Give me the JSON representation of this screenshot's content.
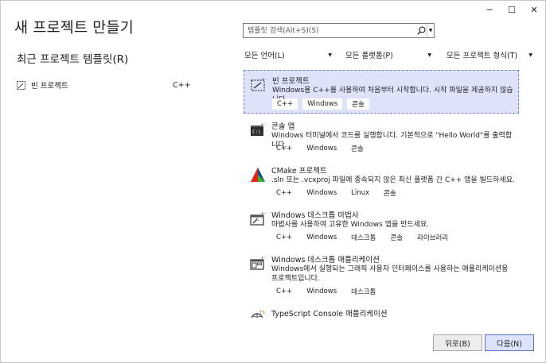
{
  "window_controls": {
    "minimize": "─",
    "maximize": "☐",
    "close": "✕"
  },
  "main_title": "새 프로젝트 만들기",
  "recent": {
    "title": "최근 프로젝트 템플릿(R)",
    "items": [
      {
        "label": "빈 프로젝트",
        "lang": "C++"
      }
    ]
  },
  "search": {
    "placeholder": "템플릿 검색(Alt+S)(S)"
  },
  "filters": [
    {
      "value": "모든 언어(L)"
    },
    {
      "value": "모든 플랫폼(P)"
    },
    {
      "value": "모든 프로젝트 형식(T)"
    }
  ],
  "templates": [
    {
      "name": "빈 프로젝트",
      "icon": "empty-project-icon",
      "description": "Windows용 C++를 사용하여 처음부터 시작합니다. 시작 파일을 제공하지 않습니다.",
      "tags": [
        "C++",
        "Windows",
        "콘솔"
      ],
      "selected": true
    },
    {
      "name": "콘솔 앱",
      "icon": "console-app-icon",
      "description": "Windows 터미널에서 코드를 실행합니다. 기본적으로 \"Hello World\"를 출력합니다.",
      "tags": [
        "C++",
        "Windows",
        "콘솔"
      ],
      "selected": false
    },
    {
      "name": "CMake 프로젝트",
      "icon": "cmake-icon",
      "description": ".sln 또는 .vcxproj 파일에 종속되지 않은 최신 플랫폼 간 C++ 앱을 빌드하세요.",
      "tags": [
        "C++",
        "Windows",
        "Linux",
        "콘솔"
      ],
      "selected": false
    },
    {
      "name": "Windows 데스크톱 마법사",
      "icon": "desktop-wizard-icon",
      "description": "마법사를 사용하여 고유한 Windows 앱을 만드세요.",
      "tags": [
        "C++",
        "Windows",
        "데스크톱",
        "콘솔",
        "라이브러리"
      ],
      "selected": false
    },
    {
      "name": "Windows 데스크톱 애플리케이션",
      "icon": "desktop-application-icon",
      "description": "Windows에서 실행되는 그래픽 사용자 인터페이스를 사용하는 애플리케이션용 프로젝트입니다.",
      "tags": [
        "C++",
        "Windows",
        "데스크톱"
      ],
      "selected": false
    },
    {
      "name": "TypeScript Console 애플리케이션",
      "icon": "typescript-console-icon",
      "description": "",
      "tags": [],
      "selected": false
    }
  ],
  "buttons": {
    "back": "뒤로(B)",
    "next": "다음(N)"
  },
  "colors": {
    "selected_bg": "#dee3f9",
    "selected_border": "#6d7fd1",
    "accent": "#5b6fcf"
  }
}
